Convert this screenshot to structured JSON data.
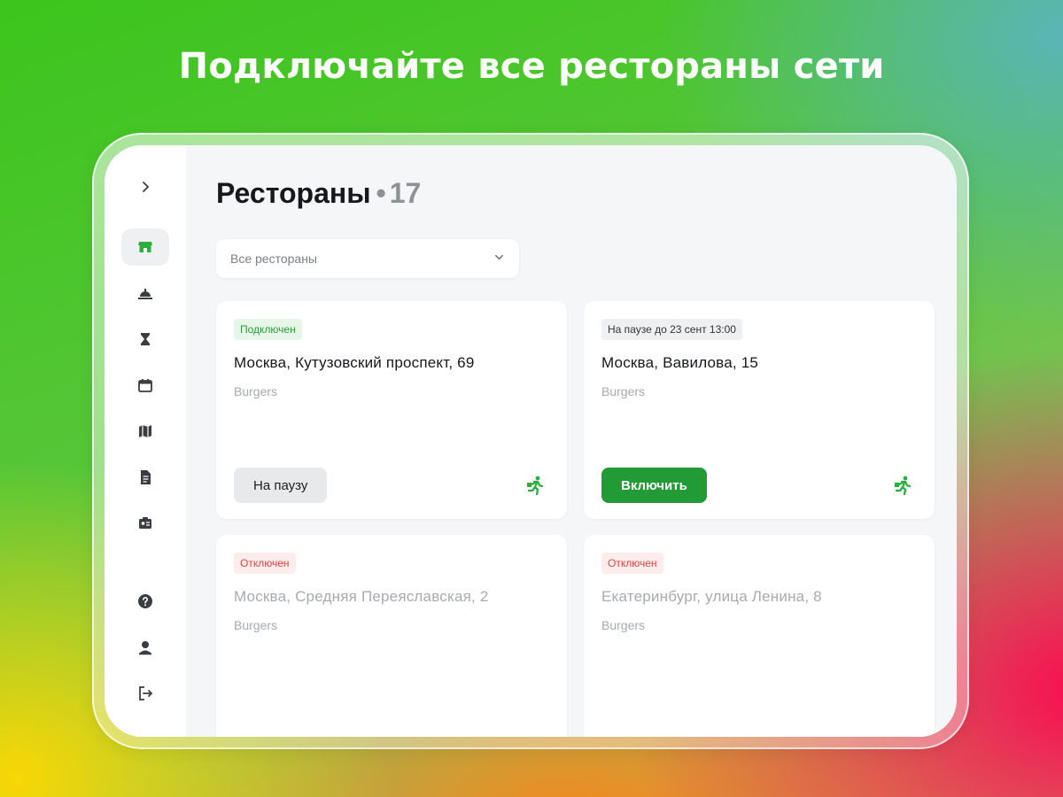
{
  "headline": "Подключайте все рестораны сети",
  "sidebar": {
    "items": [
      {
        "icon": "chevron-right-icon"
      },
      {
        "icon": "store-icon",
        "active": true
      },
      {
        "icon": "service-bell-icon"
      },
      {
        "icon": "hourglass-icon"
      },
      {
        "icon": "calendar-icon"
      },
      {
        "icon": "map-icon"
      },
      {
        "icon": "document-icon"
      },
      {
        "icon": "id-card-icon"
      },
      {
        "icon": "help-icon"
      },
      {
        "icon": "profile-icon"
      },
      {
        "icon": "logout-icon"
      }
    ]
  },
  "page": {
    "title": "Рестораны",
    "separator": "•",
    "count": "17"
  },
  "filter": {
    "value": "Все рестораны"
  },
  "cards": [
    {
      "badge": "Подключен",
      "address": "Москва, Кутузовский проспект, 69",
      "category": "Burgers",
      "button": "На паузу",
      "status_color": "#2c9a3c"
    },
    {
      "badge": "На паузе до 23 сент 13:00",
      "address": "Москва, Вавилова, 15",
      "category": "Burgers",
      "button": "Включить",
      "status_color": "#303338"
    },
    {
      "badge": "Отключен",
      "address": "Москва, Средняя Переяславская, 2",
      "category": "Burgers",
      "status_color": "#e0443f"
    },
    {
      "badge": "Отключен",
      "address": "Екатеринбург, улица Ленина, 8",
      "category": "Burgers",
      "status_color": "#e0443f"
    }
  ],
  "colors": {
    "accent_green": "#229a36",
    "courier_icon": "#2cae3f"
  }
}
